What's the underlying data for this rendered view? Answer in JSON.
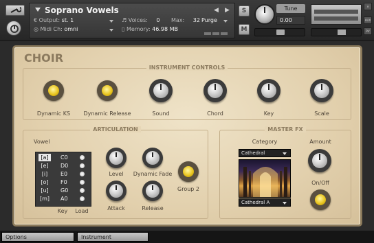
{
  "header": {
    "instrument_name": "Soprano Vowels",
    "output_label": "Output:",
    "output_value": "st. 1",
    "midi_label": "Midi Ch:",
    "midi_value": "omni",
    "voices_label": "Voices:",
    "voices_value": "0",
    "max_label": "Max:",
    "max_value": "32",
    "memory_label": "Memory:",
    "memory_value": "46.98 MB",
    "purge_label": "Purge",
    "s_label": "S",
    "m_label": "M",
    "tune_label": "Tune",
    "tune_value": "0.00",
    "aux_label": "AUX",
    "pv_label": "PV"
  },
  "choir": {
    "title": "CHOIR",
    "instrument_controls": {
      "title": "INSTRUMENT CONTROLS",
      "controls": [
        "Dynamic KS",
        "Dynamic Release",
        "Sound",
        "Chord",
        "Key",
        "Scale"
      ]
    },
    "articulation": {
      "title": "ARTICULATION",
      "vowel_label": "Vowel",
      "vowels": [
        {
          "name": "[a]",
          "key": "C0"
        },
        {
          "name": "[e]",
          "key": "D0"
        },
        {
          "name": "[i]",
          "key": "E0"
        },
        {
          "name": "[o]",
          "key": "F0"
        },
        {
          "name": "[u]",
          "key": "G0"
        },
        {
          "name": "[m]",
          "key": "A0"
        }
      ],
      "key_label": "Key",
      "load_label": "Load",
      "level_label": "Level",
      "dynamic_fade_label": "Dynamic Fade",
      "attack_label": "Attack",
      "release_label": "Release",
      "group2_label": "Group 2"
    },
    "master_fx": {
      "title": "MASTER FX",
      "category_label": "Category",
      "category_value": "Cathedral",
      "preset_value": "Cathedral A",
      "amount_label": "Amount",
      "onoff_label": "On/Off"
    }
  },
  "tabs": {
    "options": "Options",
    "instrument": "Instrument"
  },
  "colors": {
    "panel_bg": "#e6d6b6",
    "label_brown": "#8b7a5e",
    "led_yellow": "#e9c520"
  }
}
